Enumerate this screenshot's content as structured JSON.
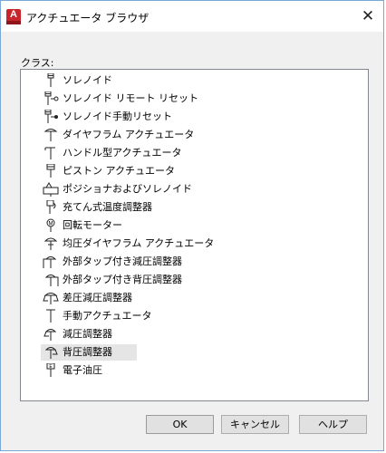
{
  "window": {
    "title": "アクチュエータ ブラウザ",
    "app_icon_letter": "A",
    "close_glyph": "✕"
  },
  "class_section": {
    "label": "クラス:",
    "items": [
      {
        "label": "ソレノイド",
        "icon": "solenoid-icon"
      },
      {
        "label": "ソレノイド リモート リセット",
        "icon": "solenoid-remote-reset-icon"
      },
      {
        "label": "ソレノイド手動リセット",
        "icon": "solenoid-manual-reset-icon"
      },
      {
        "label": "ダイヤフラム アクチュエータ",
        "icon": "diaphragm-actuator-icon"
      },
      {
        "label": "ハンドル型アクチュエータ",
        "icon": "handle-actuator-icon"
      },
      {
        "label": "ピストン アクチュエータ",
        "icon": "piston-actuator-icon"
      },
      {
        "label": "ポジショナおよびソレノイド",
        "icon": "positioner-solenoid-icon"
      },
      {
        "label": "充てん式温度調整器",
        "icon": "filled-temperature-regulator-icon"
      },
      {
        "label": "回転モーター",
        "icon": "rotary-motor-icon"
      },
      {
        "label": "均圧ダイヤフラム アクチュエータ",
        "icon": "balanced-diaphragm-actuator-icon"
      },
      {
        "label": "外部タップ付き減圧調整器",
        "icon": "external-tap-reducing-regulator-icon"
      },
      {
        "label": "外部タップ付き背圧調整器",
        "icon": "external-tap-back-pressure-regulator-icon"
      },
      {
        "label": "差圧減圧調整器",
        "icon": "differential-reducing-regulator-icon"
      },
      {
        "label": "手動アクチュエータ",
        "icon": "manual-actuator-icon"
      },
      {
        "label": "減圧調整器",
        "icon": "reducing-regulator-icon"
      },
      {
        "label": "背圧調整器",
        "icon": "back-pressure-regulator-icon"
      },
      {
        "label": "電子油圧",
        "icon": "electro-hydraulic-icon"
      }
    ],
    "selected_index": 15
  },
  "buttons": {
    "ok": "OK",
    "cancel": "キャンセル",
    "help": "ヘルプ"
  },
  "colors": {
    "accent_border": "#7aa7d6",
    "app_icon": "#c8252c",
    "selection": "#e5e5e5"
  }
}
